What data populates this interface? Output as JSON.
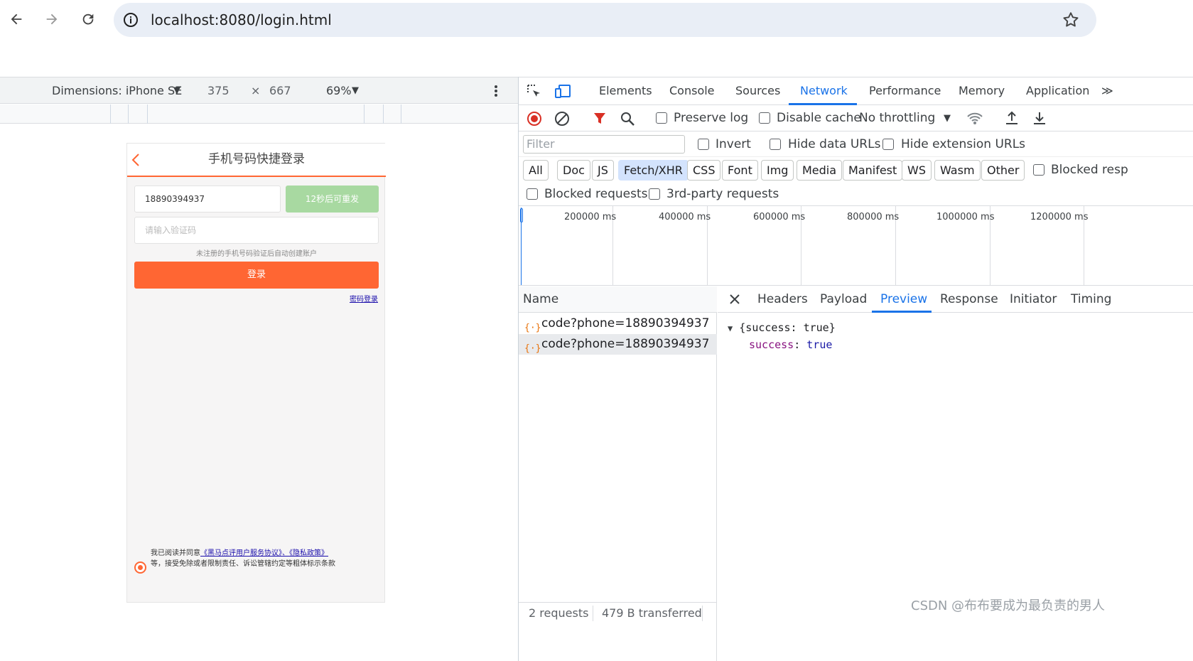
{
  "browser": {
    "url": "localhost:8080/login.html"
  },
  "device_toolbar": {
    "dimensions_label": "Dimensions: iPhone SE",
    "width": "375",
    "times": "×",
    "height": "667",
    "zoom": "69%"
  },
  "phone": {
    "title": "手机号码快捷登录",
    "phone_value": "18890394937",
    "resend_label": "12秒后可重发",
    "code_placeholder": "请输入验证码",
    "hint": "未注册的手机号码验证后自动创建账户",
    "login_label": "登录",
    "password_login": "密码登录",
    "agree_prefix": "我已阅读并同意",
    "agree_link1": "《黑马点评用户服务协议》",
    "agree_sep": "、",
    "agree_link2": "《隐私政策》",
    "agree_suffix": "等，接受免除或者限制责任、诉讼管辖约定等粗体标示条款"
  },
  "devtools": {
    "tabs": [
      "Elements",
      "Console",
      "Sources",
      "Network",
      "Performance",
      "Memory",
      "Application"
    ],
    "active_tab": "Network",
    "more": "≫",
    "toolbar": {
      "preserve_log": "Preserve log",
      "disable_cache": "Disable cache",
      "throttling": "No throttling"
    },
    "filter": {
      "placeholder": "Filter",
      "invert": "Invert",
      "hide_data_urls": "Hide data URLs",
      "hide_extension_urls": "Hide extension URLs"
    },
    "chips": [
      "All",
      "Doc",
      "JS",
      "Fetch/XHR",
      "CSS",
      "Font",
      "Img",
      "Media",
      "Manifest",
      "WS",
      "Wasm",
      "Other"
    ],
    "selected_chip": "Fetch/XHR",
    "blocked_resp": "Blocked resp",
    "blocked_requests": "Blocked requests",
    "third_party": "3rd-party requests",
    "timeline_labels": [
      "200000 ms",
      "400000 ms",
      "600000 ms",
      "800000 ms",
      "1000000 ms",
      "1200000 ms"
    ],
    "name_header": "Name",
    "requests": [
      "code?phone=18890394937",
      "code?phone=18890394937"
    ],
    "status_requests": "2 requests",
    "status_transferred": "479 B transferred",
    "detail_tabs": [
      "Headers",
      "Payload",
      "Preview",
      "Response",
      "Initiator",
      "Timing"
    ],
    "active_detail_tab": "Preview",
    "preview": {
      "summary": "{success: true}",
      "key": "success",
      "value": "true"
    }
  },
  "watermark": "CSDN @布布要成为最负责的男人",
  "colors": {
    "accent": "#1a73e8",
    "brand": "#ff6633",
    "resend_bg": "#a8d9a1"
  }
}
